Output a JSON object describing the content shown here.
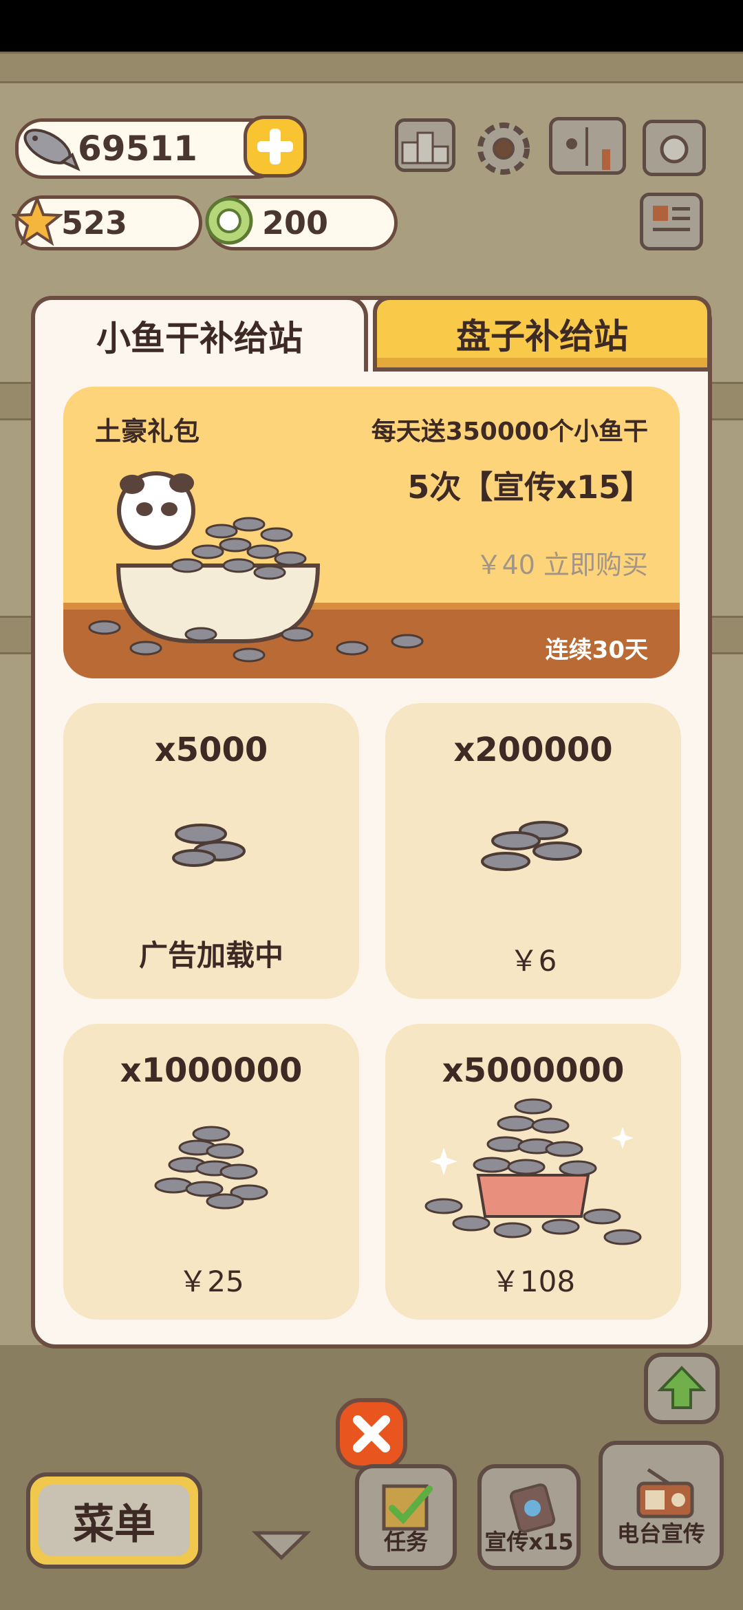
{
  "hud": {
    "fish_count": "69511",
    "star_count": "523",
    "plate_count": "200",
    "icons": [
      "fish-icon",
      "plus-icon",
      "star-icon",
      "plate-icon",
      "ranking-icon",
      "gear-icon",
      "book-icon",
      "camera-icon",
      "newspaper-icon"
    ]
  },
  "tabs": [
    {
      "label": "小鱼干补给站",
      "active": true
    },
    {
      "label": "盘子补给站",
      "active": false
    }
  ],
  "banner": {
    "title": "土豪礼包",
    "line1": "每天送350000个小鱼干",
    "line2": "5次【宣传x15】",
    "price": "￥40 立即购买",
    "duration": "连续30天"
  },
  "cards": [
    {
      "qty": "x5000",
      "price": "广告加载中",
      "bold": true
    },
    {
      "qty": "x200000",
      "price": "￥6",
      "bold": false
    },
    {
      "qty": "x1000000",
      "price": "￥25",
      "bold": false
    },
    {
      "qty": "x5000000",
      "price": "￥108",
      "bold": false
    }
  ],
  "bottom": {
    "menu_label": "菜单",
    "task_label": "任务",
    "promo_label": "宣传x15",
    "radio_label": "电台宣传"
  },
  "colors": {
    "panel_bg": "#fdf6ee",
    "border": "#6c4d42",
    "tab_inactive": "#f9c94a",
    "close_button": "#e8551e",
    "card_bg": "#f6e6c4"
  }
}
